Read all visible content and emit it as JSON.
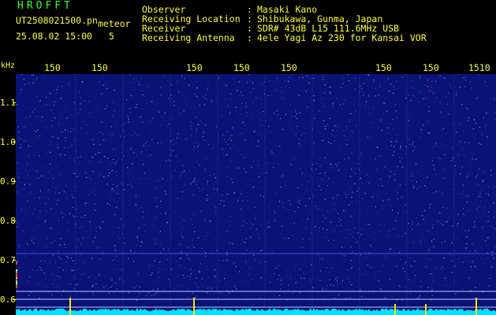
{
  "header": {
    "brand": "HROFFT",
    "filename": "UT2508021500.pn",
    "filename_suffix": "meteor",
    "datetime": "25.08.02 15:00",
    "count": "5",
    "meta": [
      {
        "label": "Observer",
        "value": "Masaki Kano"
      },
      {
        "label": "Receiving Location",
        "value": "Shibukawa, Gunma, Japan"
      },
      {
        "label": "Receiver",
        "value": "SDR# 43dB L15 111.6MHz USB"
      },
      {
        "label": "Receiving Antenna",
        "value": "4ele Yagi Az 230 for Kansai VOR"
      }
    ]
  },
  "x_axis": {
    "ticks": [
      "150",
      "150",
      "150",
      "150",
      "150",
      "150",
      "150",
      "1510"
    ]
  },
  "y_axis": {
    "unit": "kHz",
    "labels": [
      "1.1",
      "1.0",
      "0.9",
      "0.8",
      "0.7",
      "0.6"
    ]
  },
  "colors": {
    "label_yellow": "#ffff33",
    "brand_green": "#33ff33",
    "background_blue": "#0a1275",
    "noise_cyan": "#00e0ff",
    "trace_yellow": "#ffe200"
  }
}
